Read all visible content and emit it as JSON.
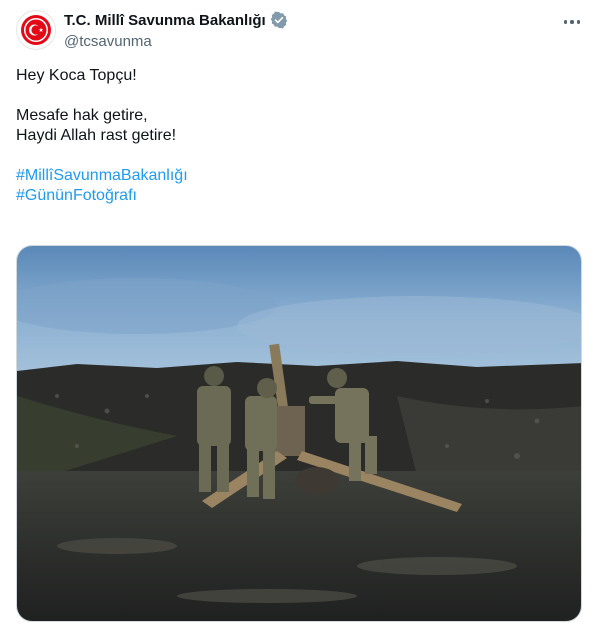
{
  "account": {
    "display_name": "T.C. Millî Savunma Bakanlığı",
    "handle": "@tcsavunma",
    "verified_icon": "verified-badge-icon",
    "avatar_icon": "ministry-emblem-icon"
  },
  "menu": {
    "icon": "more-options-icon"
  },
  "tweet": {
    "lines": {
      "l1": "Hey Koca Topçu!",
      "l2": "Mesafe hak getire,",
      "l3": "Haydi Allah rast getire!"
    },
    "hashtags": [
      "#MillîSavunmaBakanlığı",
      "#GününFotoğrafı"
    ]
  },
  "colors": {
    "link": "#1d9bf0",
    "verified": "#829aab",
    "emblem_red": "#e30a17",
    "secondary_text": "#536471"
  }
}
